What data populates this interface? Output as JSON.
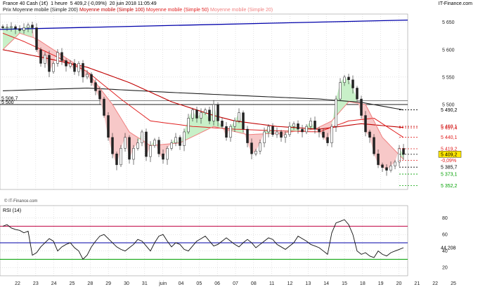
{
  "header": {
    "title": "France 40 Cash (1€)",
    "interval": "1 heure",
    "price_info": "5 409,2 (-0,09%)",
    "datetime": "20 juin 2018 11:05:49",
    "brand": "IT-Finance.com"
  },
  "legend": {
    "items": [
      {
        "label": "Prix",
        "color": "#222222"
      },
      {
        "label": "Moyenne mobile (Simple 200)",
        "color": "#222222"
      },
      {
        "label": "Moyenne mobile (Simple 100)",
        "color": "#c00000"
      },
      {
        "label": "Moyenne mobile (Simple 50)",
        "color": "#e02020"
      },
      {
        "label": "Moyenne mobile (Simple 20)",
        "color": "#f08080"
      }
    ]
  },
  "footer": {
    "copyright": "© IT-Finance.com"
  },
  "rsi_label": "RSI (14)",
  "colors": {
    "price": "#222222",
    "sma200": "#222222",
    "sma100": "#c00000",
    "sma50": "#e02020",
    "sma20": "#f08080",
    "trendline": "#0000aa",
    "fill_below": "#f7c8c8",
    "fill_above": "#c8f0c8",
    "rsi_line": "#111111",
    "rsi_upper": "#c00040",
    "rsi_mid": "#0000aa",
    "rsi_lower": "#00a000"
  },
  "chart_data": [
    {
      "type": "candlestick",
      "title": "France 40 Cash (1€)",
      "x_labels": [
        "22",
        "23",
        "24",
        "25",
        "28",
        "29",
        "30",
        "31",
        "juin",
        "04",
        "05",
        "06",
        "07",
        "08",
        "11",
        "12",
        "13",
        "14",
        "15",
        "18",
        "19",
        "20",
        "21",
        "22",
        "25"
      ],
      "ylim": [
        5345,
        5665
      ],
      "y_ticks": [
        "5 650",
        "5 600",
        "5 550",
        "5 500"
      ],
      "levels": [
        {
          "label": "5 506,7",
          "value": 5506.7,
          "side": "left"
        },
        {
          "label": "5 500",
          "value": 5500.0,
          "side": "left"
        },
        {
          "label": "5 490,2",
          "value": 5490.2,
          "color": "#000000"
        },
        {
          "label": "5 460,1",
          "value": 5460.1,
          "color": "#c00000"
        },
        {
          "label": "5 457,4",
          "value": 5457.4,
          "color": "#e02020"
        },
        {
          "label": "5 440,1",
          "value": 5440.1,
          "color": "#e02020"
        },
        {
          "label": "5 419,2",
          "value": 5419.2,
          "color": "#e02020"
        },
        {
          "label": "5 409,2",
          "value": 5409.2,
          "color": "#000000",
          "highlight": true
        },
        {
          "label": "-0,09%",
          "value": 5398.0,
          "color": "#e02020"
        },
        {
          "label": "5 385,7",
          "value": 5385.7,
          "color": "#000000"
        },
        {
          "label": "5 373,1",
          "value": 5373.1,
          "color": "#00a000"
        },
        {
          "label": "5 352,2",
          "value": 5352.2,
          "color": "#00a000"
        }
      ],
      "trendline": {
        "start": 5637,
        "end": 5654
      },
      "price_anchors": [
        [
          0,
          5640
        ],
        [
          2,
          5642
        ],
        [
          4,
          5635
        ],
        [
          6,
          5645
        ],
        [
          7,
          5640
        ],
        [
          8,
          5600
        ],
        [
          9,
          5575
        ],
        [
          10,
          5590
        ],
        [
          11,
          5560
        ],
        [
          12,
          5575
        ],
        [
          13,
          5595
        ],
        [
          14,
          5580
        ],
        [
          15,
          5570
        ],
        [
          16,
          5575
        ],
        [
          17,
          5560
        ],
        [
          18,
          5575
        ],
        [
          19,
          5550
        ],
        [
          20,
          5555
        ],
        [
          21,
          5540
        ],
        [
          22,
          5525
        ],
        [
          23,
          5510
        ],
        [
          24,
          5480
        ],
        [
          25,
          5440
        ],
        [
          26,
          5410
        ],
        [
          27,
          5390
        ],
        [
          28,
          5420
        ],
        [
          29,
          5440
        ],
        [
          30,
          5400
        ],
        [
          31,
          5420
        ],
        [
          32,
          5430
        ],
        [
          33,
          5450
        ],
        [
          34,
          5405
        ],
        [
          35,
          5425
        ],
        [
          36,
          5435
        ],
        [
          37,
          5410
        ],
        [
          38,
          5400
        ],
        [
          39,
          5420
        ],
        [
          40,
          5430
        ],
        [
          41,
          5440
        ],
        [
          42,
          5425
        ],
        [
          43,
          5450
        ],
        [
          44,
          5475
        ],
        [
          45,
          5490
        ],
        [
          46,
          5475
        ],
        [
          47,
          5485
        ],
        [
          48,
          5490
        ],
        [
          49,
          5470
        ],
        [
          50,
          5500
        ],
        [
          51,
          5470
        ],
        [
          52,
          5460
        ],
        [
          53,
          5440
        ],
        [
          54,
          5460
        ],
        [
          55,
          5470
        ],
        [
          56,
          5485
        ],
        [
          57,
          5455
        ],
        [
          58,
          5430
        ],
        [
          59,
          5410
        ],
        [
          60,
          5415
        ],
        [
          61,
          5430
        ],
        [
          62,
          5450
        ],
        [
          63,
          5460
        ],
        [
          64,
          5445
        ],
        [
          65,
          5450
        ],
        [
          66,
          5440
        ],
        [
          67,
          5445
        ],
        [
          68,
          5460
        ],
        [
          69,
          5465
        ],
        [
          70,
          5455
        ],
        [
          71,
          5450
        ],
        [
          72,
          5460
        ],
        [
          73,
          5470
        ],
        [
          74,
          5455
        ],
        [
          75,
          5450
        ],
        [
          76,
          5440
        ],
        [
          77,
          5430
        ],
        [
          78,
          5460
        ],
        [
          79,
          5510
        ],
        [
          80,
          5540
        ],
        [
          81,
          5550
        ],
        [
          82,
          5545
        ],
        [
          83,
          5530
        ],
        [
          84,
          5510
        ],
        [
          85,
          5480
        ],
        [
          86,
          5450
        ],
        [
          87,
          5440
        ],
        [
          88,
          5410
        ],
        [
          89,
          5390
        ],
        [
          90,
          5385
        ],
        [
          91,
          5380
        ],
        [
          92,
          5388
        ],
        [
          93,
          5395
        ],
        [
          94,
          5420
        ],
        [
          95,
          5409
        ]
      ],
      "sma200_anchors": [
        [
          0,
          5525
        ],
        [
          20,
          5530
        ],
        [
          40,
          5522
        ],
        [
          60,
          5515
        ],
        [
          75,
          5510
        ],
        [
          85,
          5504
        ],
        [
          95,
          5490
        ]
      ],
      "sma100_anchors": [
        [
          0,
          5600
        ],
        [
          10,
          5585
        ],
        [
          20,
          5568
        ],
        [
          30,
          5540
        ],
        [
          40,
          5505
        ],
        [
          50,
          5480
        ],
        [
          55,
          5470
        ],
        [
          65,
          5460
        ],
        [
          75,
          5455
        ],
        [
          85,
          5465
        ],
        [
          95,
          5458
        ]
      ],
      "sma50_anchors": [
        [
          0,
          5630
        ],
        [
          5,
          5615
        ],
        [
          12,
          5590
        ],
        [
          20,
          5560
        ],
        [
          28,
          5510
        ],
        [
          35,
          5470
        ],
        [
          45,
          5460
        ],
        [
          55,
          5455
        ],
        [
          65,
          5452
        ],
        [
          75,
          5450
        ],
        [
          82,
          5470
        ],
        [
          88,
          5475
        ],
        [
          95,
          5440
        ]
      ],
      "sma20_anchors": [
        [
          0,
          5600
        ],
        [
          4,
          5630
        ],
        [
          8,
          5620
        ],
        [
          14,
          5590
        ],
        [
          20,
          5560
        ],
        [
          26,
          5500
        ],
        [
          30,
          5450
        ],
        [
          35,
          5425
        ],
        [
          42,
          5430
        ],
        [
          50,
          5460
        ],
        [
          58,
          5445
        ],
        [
          66,
          5448
        ],
        [
          74,
          5455
        ],
        [
          78,
          5470
        ],
        [
          82,
          5505
        ],
        [
          86,
          5500
        ],
        [
          90,
          5440
        ],
        [
          95,
          5400
        ]
      ]
    },
    {
      "type": "line",
      "title": "RSI (14)",
      "ylim": [
        10,
        95
      ],
      "y_ticks": [
        80,
        60,
        40,
        20
      ],
      "levels": [
        70,
        50,
        30
      ],
      "last_value": "44,208",
      "values": [
        70,
        72,
        68,
        66,
        65,
        62,
        64,
        35,
        38,
        45,
        50,
        55,
        52,
        40,
        45,
        48,
        50,
        44,
        40,
        30,
        35,
        45,
        52,
        58,
        60,
        55,
        50,
        45,
        42,
        40,
        44,
        48,
        54,
        52,
        46,
        40,
        50,
        58,
        60,
        52,
        45,
        50,
        48,
        42,
        40,
        46,
        52,
        55,
        58,
        52,
        46,
        48,
        52,
        56,
        52,
        48,
        45,
        50,
        54,
        50,
        44,
        48,
        52,
        56,
        54,
        48,
        45,
        42,
        46,
        50,
        58,
        55,
        52,
        48,
        46,
        44,
        40,
        36,
        62,
        74,
        76,
        78,
        72,
        60,
        40,
        36,
        38,
        34,
        32,
        40,
        36,
        34,
        38,
        40,
        42,
        44
      ]
    }
  ]
}
